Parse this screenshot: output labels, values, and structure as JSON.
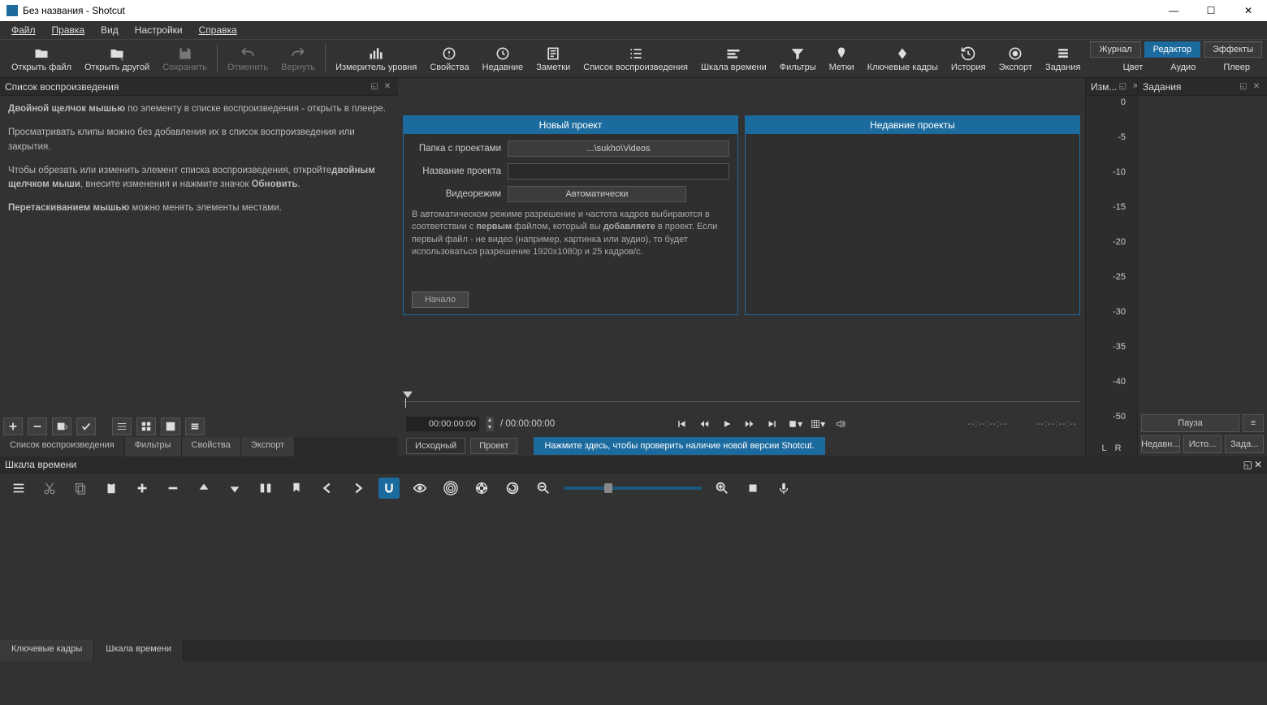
{
  "window": {
    "title": "Без названия - Shotcut"
  },
  "menu": [
    "Файл",
    "Правка",
    "Вид",
    "Настройки",
    "Справка"
  ],
  "toolbar": [
    {
      "id": "open-file",
      "label": "Открыть файл"
    },
    {
      "id": "open-other",
      "label": "Открыть другой"
    },
    {
      "id": "save",
      "label": "Сохранить",
      "disabled": true
    },
    {
      "id": "undo",
      "label": "Отменить",
      "disabled": true
    },
    {
      "id": "redo",
      "label": "Вернуть",
      "disabled": true
    },
    {
      "id": "peakmeter",
      "label": "Измеритель уровня"
    },
    {
      "id": "properties",
      "label": "Свойства"
    },
    {
      "id": "recent",
      "label": "Недавние"
    },
    {
      "id": "notes",
      "label": "Заметки"
    },
    {
      "id": "playlist",
      "label": "Список воспроизведения"
    },
    {
      "id": "timeline",
      "label": "Шкала времени"
    },
    {
      "id": "filters",
      "label": "Фильтры"
    },
    {
      "id": "markers",
      "label": "Метки"
    },
    {
      "id": "keyframes",
      "label": "Ключевые кадры"
    },
    {
      "id": "history",
      "label": "История"
    },
    {
      "id": "export",
      "label": "Экспорт"
    },
    {
      "id": "jobs",
      "label": "Задания"
    }
  ],
  "layouts": {
    "row1": [
      {
        "l": "Журнал"
      },
      {
        "l": "Редактор",
        "active": true
      },
      {
        "l": "Эффекты"
      }
    ],
    "row2": [
      {
        "l": "Цвет"
      },
      {
        "l": "Аудио"
      },
      {
        "l": "Плеер"
      }
    ]
  },
  "playlist": {
    "title": "Список воспроизведения",
    "help_dblclick_b": "Двойной щелчок мышью",
    "help_dblclick_rest": " по элементу в списке воспроизведения - открыть в плеере.",
    "help_preview": "Просматривать клипы можно без добавления их в список воспроизведения или закрытия.",
    "help_trim1": "Чтобы обрезать или изменить элемент списка воспроизведения, откройте",
    "help_trim_b": "двойным щелчком мыши",
    "help_trim2": ", внесите изменения и нажмите значок ",
    "help_trim_b2": "Обновить",
    "help_trim3": ".",
    "help_drag_b": "Перетаскиванием мышью",
    "help_drag_rest": " можно менять элементы местами.",
    "tabs": [
      "Список воспроизведения",
      "Фильтры",
      "Свойства",
      "Экспорт"
    ]
  },
  "newproject": {
    "title": "Новый проект",
    "folder_label": "Папка с проектами",
    "folder_value": "...\\sukho\\Videos",
    "name_label": "Название проекта",
    "name_value": "",
    "mode_label": "Видеорежим",
    "mode_value": "Автоматически",
    "desc1": "В автоматическом режиме разрешение и частота кадров выбираются в соответствии с ",
    "desc_b1": "первым",
    "desc2": " файлом, который вы ",
    "desc_b2": "добавляете",
    "desc3": " в проект. Если первый файл - не видео (например, картинка или аудио), то будет использоваться разрешение 1920x1080p и 25 кадров/с.",
    "start": "Начало"
  },
  "recent": {
    "title": "Недавние проекты"
  },
  "player": {
    "tc": "00:00:00:00",
    "total": "/ 00:00:00:00",
    "blank": "--:--:--:--",
    "src": "Исходный",
    "proj": "Проект",
    "update": "Нажмите здесь, чтобы проверить наличие новой версии Shotcut."
  },
  "meter": {
    "title": "Изм...",
    "labels": [
      "0",
      "-5",
      "-10",
      "-15",
      "-20",
      "-25",
      "-30",
      "-35",
      "-40",
      "-50"
    ],
    "L": "L",
    "R": "R"
  },
  "tasks": {
    "title": "Задания",
    "pause": "Пауза",
    "t1": "Недавн...",
    "t2": "Исто...",
    "t3": "Зада..."
  },
  "timeline": {
    "title": "Шкала времени"
  },
  "bottomtabs": [
    "Ключевые кадры",
    "Шкала времени"
  ]
}
